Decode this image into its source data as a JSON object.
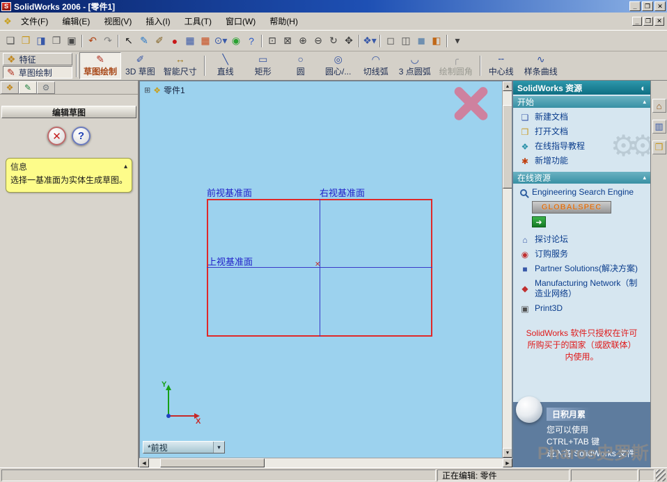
{
  "window": {
    "title": "SolidWorks 2006 - [零件1]",
    "app_icon_letter": "S",
    "controls": {
      "minimize": "_",
      "restore": "❐",
      "close": "✕"
    }
  },
  "menu": {
    "doc_icon_glyph": "❖",
    "items": [
      "文件(F)",
      "编辑(E)",
      "视图(V)",
      "插入(I)",
      "工具(T)",
      "窗口(W)",
      "帮助(H)"
    ],
    "child_controls": {
      "minimize": "_",
      "restore": "❐",
      "close": "✕"
    }
  },
  "toolbar_std": {
    "icons": [
      {
        "name": "new-document-button",
        "glyph": "❏",
        "color": "#505050"
      },
      {
        "name": "open-document-button",
        "glyph": "❒",
        "color": "#C89820"
      },
      {
        "name": "save-button",
        "glyph": "◨",
        "color": "#3858A8"
      },
      {
        "name": "print-preview-button",
        "glyph": "❐",
        "color": "#606060"
      },
      {
        "name": "print-button",
        "glyph": "▣",
        "color": "#484848"
      },
      {
        "sep": true,
        "name": "toolbar-separator",
        "inter": "false"
      },
      {
        "name": "undo-button",
        "glyph": "↶",
        "color": "#B04010"
      },
      {
        "name": "redo-button",
        "glyph": "↷",
        "color": "#808080"
      },
      {
        "sep": true,
        "name": "toolbar-separator",
        "inter": "false"
      },
      {
        "name": "select-button",
        "glyph": "↖",
        "color": "#202020"
      },
      {
        "name": "sketch-button-small",
        "glyph": "✎",
        "color": "#2878C8"
      },
      {
        "name": "annotation-button",
        "glyph": "✐",
        "color": "#806020"
      },
      {
        "name": "record-macro-button",
        "glyph": "●",
        "color": "#C81818"
      },
      {
        "name": "design-table-button",
        "glyph": "▦",
        "color": "#3858A8"
      },
      {
        "name": "edit-color-button",
        "glyph": "▦",
        "color": "#C84818"
      },
      {
        "name": "zoom-select-combo",
        "glyph": "⊙▾",
        "color": "#3858A8"
      },
      {
        "name": "rebuild-button",
        "glyph": "◉",
        "color": "#28A030"
      },
      {
        "name": "help-button",
        "glyph": "?",
        "color": "#2858C8"
      },
      {
        "sep": true,
        "name": "toolbar-separator",
        "inter": "false"
      },
      {
        "name": "zoom-to-fit-button",
        "glyph": "⊡",
        "color": "#404040"
      },
      {
        "name": "zoom-to-area-button",
        "glyph": "⊠",
        "color": "#404040"
      },
      {
        "name": "zoom-in-button",
        "glyph": "⊕",
        "color": "#404040"
      },
      {
        "name": "zoom-out-button",
        "glyph": "⊖",
        "color": "#404040"
      },
      {
        "name": "rotate-view-button",
        "glyph": "↻",
        "color": "#404040"
      },
      {
        "name": "pan-button",
        "glyph": "✥",
        "color": "#404040"
      },
      {
        "sep": true,
        "name": "toolbar-separator",
        "inter": "false"
      },
      {
        "name": "standard-views-combo",
        "glyph": "❖▾",
        "color": "#3858A8"
      },
      {
        "sep": true,
        "name": "toolbar-separator",
        "inter": "false"
      },
      {
        "name": "wireframe-button",
        "glyph": "◻",
        "color": "#505050"
      },
      {
        "name": "hidden-lines-button",
        "glyph": "◫",
        "color": "#505050"
      },
      {
        "name": "shaded-button",
        "glyph": "◼",
        "color": "#7090B0"
      },
      {
        "name": "section-view-button",
        "glyph": "◧",
        "color": "#C06818"
      },
      {
        "sep": true,
        "name": "toolbar-separator",
        "inter": "false"
      },
      {
        "name": "view-orientation-button",
        "glyph": "▾",
        "color": "#404040"
      }
    ]
  },
  "command_tabs": [
    {
      "name": "tab-features",
      "label": "特征",
      "glyph": "❖",
      "color": "#C08820"
    },
    {
      "name": "tab-sketch",
      "label": "草图绘制",
      "glyph": "✎",
      "color": "#B03020",
      "active": true
    }
  ],
  "sketch_toolbar": {
    "buttons": [
      {
        "name": "sketch-button",
        "glyph": "✎",
        "color": "#B03020",
        "label": "草图绘制",
        "active": true
      },
      {
        "name": "3d-sketch-button",
        "glyph": "✐",
        "color": "#3858A8",
        "label": "3D 草图"
      },
      {
        "name": "smart-dimension-button",
        "glyph": "↔",
        "color": "#A07818",
        "label": "智能尺寸"
      },
      {
        "sep": true,
        "name": "toolbar-separator",
        "inter": "false"
      },
      {
        "name": "line-button",
        "glyph": "╲",
        "color": "#3050A0",
        "label": "直线"
      },
      {
        "name": "rectangle-button",
        "glyph": "▭",
        "color": "#3050A0",
        "label": "矩形"
      },
      {
        "name": "circle-button",
        "glyph": "○",
        "color": "#3050A0",
        "label": "圆"
      },
      {
        "name": "centerpoint-circle-button",
        "glyph": "◎",
        "color": "#3050A0",
        "label": "圆心/..."
      },
      {
        "name": "tangent-arc-button",
        "glyph": "◠",
        "color": "#3050A0",
        "label": "切线弧"
      },
      {
        "name": "three-point-arc-button",
        "glyph": "◡",
        "color": "#3050A0",
        "label": "3 点圆弧"
      },
      {
        "name": "sketch-fillet-button",
        "glyph": "╭",
        "color": "#A0A0A0",
        "label": "绘制圆角",
        "disabled": true
      },
      {
        "sep": true,
        "name": "toolbar-separator",
        "inter": "false"
      },
      {
        "name": "centerline-button",
        "glyph": "╌",
        "color": "#3050A0",
        "label": "中心线"
      },
      {
        "name": "spline-button",
        "glyph": "∿",
        "color": "#3050A0",
        "label": "样条曲线"
      }
    ]
  },
  "property_panel": {
    "tabs": [
      {
        "name": "tab-featuremanager",
        "glyph": "❖",
        "color": "#C08820"
      },
      {
        "name": "tab-propertymanager",
        "glyph": "✎",
        "color": "#208040",
        "active": true
      },
      {
        "name": "tab-configurationmanager",
        "glyph": "⚙",
        "color": "#707880"
      }
    ],
    "title": "编辑草图",
    "close_glyph": "✕",
    "help_glyph": "?",
    "info": {
      "header": "信息",
      "text": "选择一基准面为实体生成草图。"
    }
  },
  "viewport": {
    "expand_glyph": "⊞",
    "doc_icon_glyph": "❖",
    "doc_label": "零件1",
    "plane_front": "前视基准面",
    "plane_right": "右视基准面",
    "plane_top": "上视基准面",
    "origin_glyph": "✕",
    "axis_x": "X",
    "axis_y": "Y",
    "view_selector": "*前视"
  },
  "task_pane": {
    "title": "SolidWorks 资源",
    "globe_glyph": "◐",
    "gears_glyph": "⚙⚙",
    "start": {
      "title": "开始",
      "items": [
        {
          "name": "new-document-link",
          "glyph": "❏",
          "color": "#3858A8",
          "label": "新建文档"
        },
        {
          "name": "open-document-link",
          "glyph": "❒",
          "color": "#C89820",
          "label": "打开文档"
        },
        {
          "name": "online-tutorials-link",
          "glyph": "❖",
          "color": "#2890A8",
          "label": "在线指导教程"
        },
        {
          "name": "whats-new-link",
          "glyph": "✱",
          "color": "#C04010",
          "label": "新增功能"
        }
      ]
    },
    "online": {
      "title": "在线资源",
      "search_label": "Engineering Search Engine",
      "globalspec": "GLOBALSPEC",
      "go_glyph": "➜",
      "items": [
        {
          "name": "discussion-forum-link",
          "glyph": "⌂",
          "color": "#3858A8",
          "label": "探讨论坛"
        },
        {
          "name": "subscription-service-link",
          "glyph": "◉",
          "color": "#C03030",
          "label": "订购服务"
        },
        {
          "name": "partner-solutions-link",
          "glyph": "■",
          "color": "#3858A8",
          "label": "Partner Solutions(解决方案)"
        },
        {
          "name": "manufacturing-network-link",
          "glyph": "◆",
          "color": "#C03030",
          "label": "Manufacturing Network（制造业网络）"
        },
        {
          "name": "print3d-link",
          "glyph": "▣",
          "color": "#505050",
          "label": "Print3D"
        }
      ]
    },
    "license": [
      "SolidWorks 软件只授权在许可",
      "所购买于的国家（或欧联体）",
      "内使用。"
    ],
    "tip": {
      "title": "日积月累",
      "lines": [
        "您可以使用",
        "CTRL+TAB 键",
        "进入各 SolidWorks 文件"
      ]
    },
    "side_tabs": [
      {
        "name": "tab-solidworks-resources",
        "glyph": "⌂",
        "color": "#905010"
      },
      {
        "name": "tab-design-library",
        "glyph": "▥",
        "color": "#3858A8"
      },
      {
        "name": "tab-file-explorer",
        "glyph": "❒",
        "color": "#C89820"
      }
    ]
  },
  "statusbar": {
    "editing": "正在编辑: 零件"
  },
  "watermark": {
    "text": "Pharos史罗斯"
  },
  "colors": {
    "viewport_bg": "#9CD2EE",
    "sketch_red": "#E02828",
    "sketch_blue": "#3838C8",
    "accent_teal": "#2E8CA0"
  }
}
